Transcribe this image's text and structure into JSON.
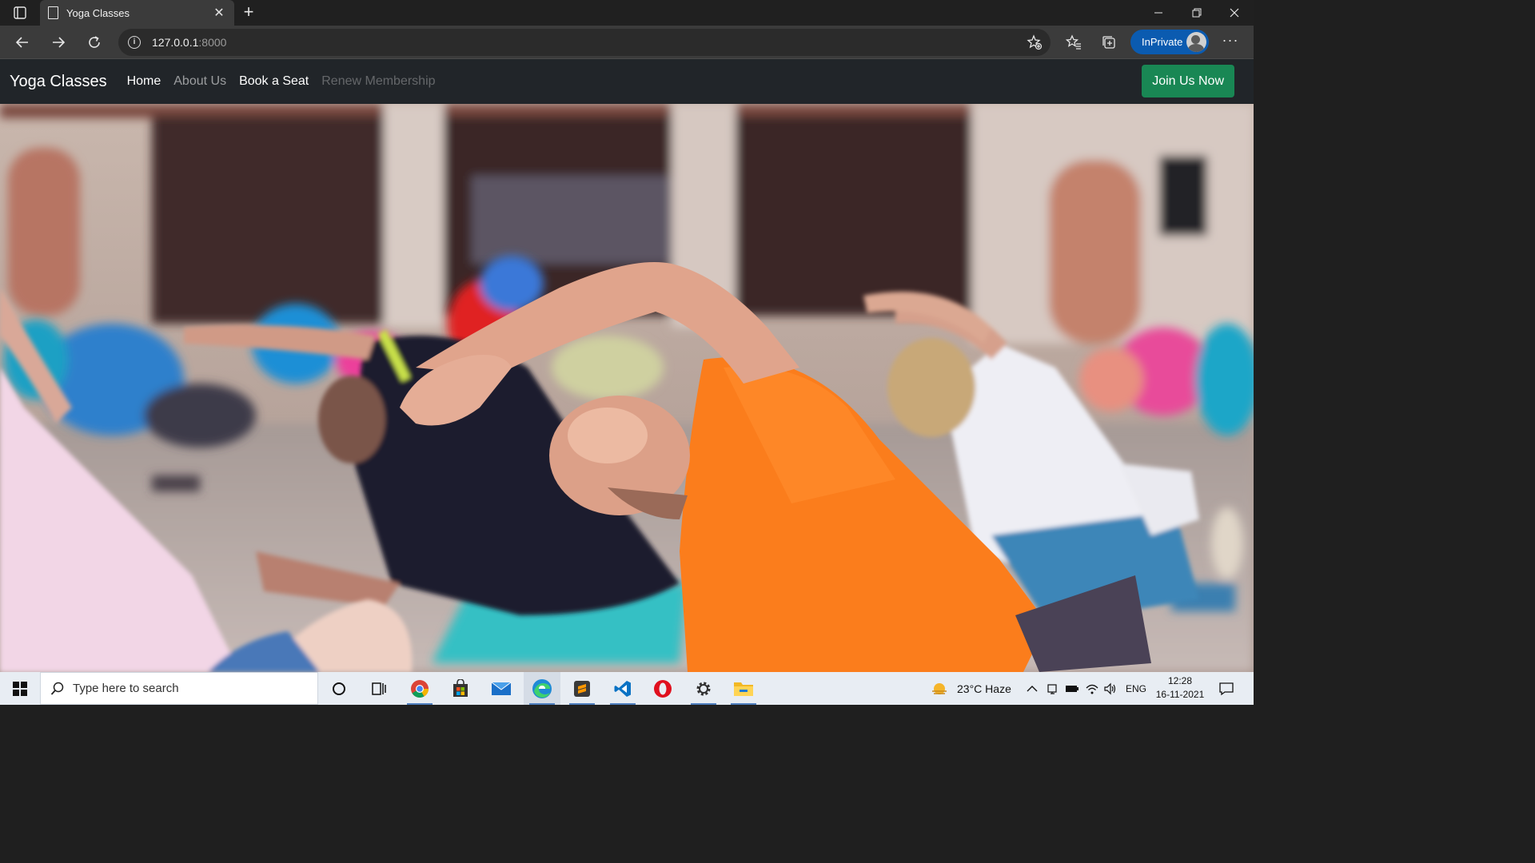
{
  "browser": {
    "tab_title": "Yoga Classes",
    "address_host": "127.0.0.1",
    "address_port": ":8000",
    "inprivate_label": "InPrivate",
    "more_label": "···"
  },
  "site": {
    "brand": "Yoga Classes",
    "nav": [
      {
        "label": "Home",
        "state": "active"
      },
      {
        "label": "About Us",
        "state": "normal"
      },
      {
        "label": "Book a Seat",
        "state": "bright"
      },
      {
        "label": "Renew Membership",
        "state": "disabled"
      }
    ],
    "cta_label": "Join Us Now",
    "colors": {
      "navbar_bg": "#212529",
      "cta_bg": "#198754"
    }
  },
  "hero": {
    "description_icon": "hero-photo"
  },
  "taskbar": {
    "search_placeholder": "Type here to search",
    "weather": "23°C  Haze",
    "language": "ENG",
    "time": "12:28",
    "date": "16-11-2021",
    "apps": [
      "task-view",
      "widgets",
      "chrome",
      "store",
      "mail",
      "edge",
      "sublime-text",
      "vscode",
      "opera",
      "settings",
      "file-explorer"
    ]
  }
}
